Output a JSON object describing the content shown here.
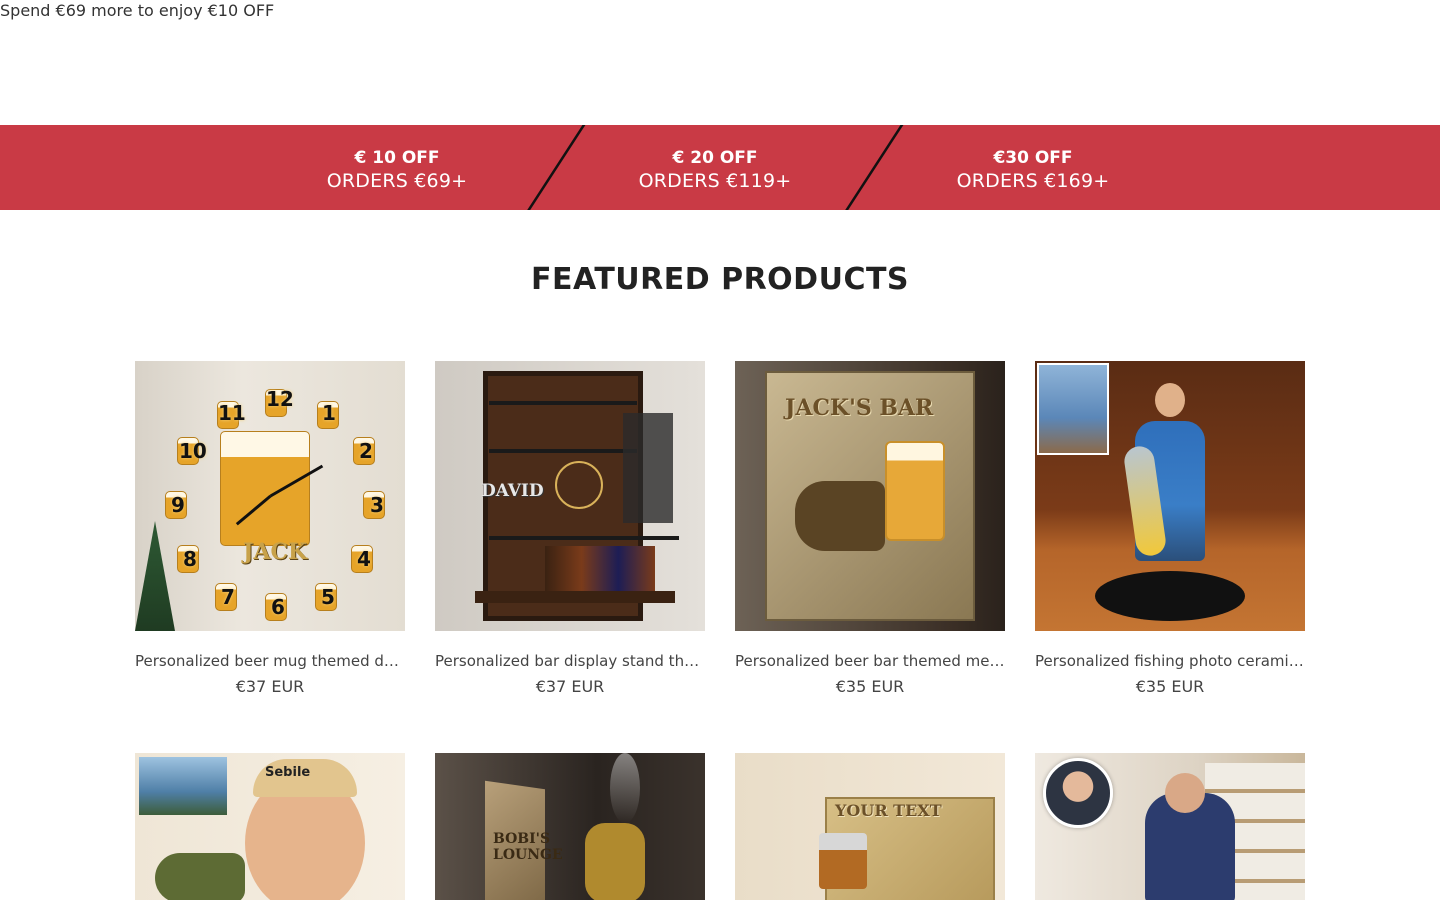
{
  "announcement": {
    "text": "Spend €69 more to enjoy €10 OFF"
  },
  "promo": {
    "tiers": [
      {
        "amount": "€ 10 OFF",
        "orders": "ORDERS €69+"
      },
      {
        "amount": "€ 20 OFF",
        "orders": "ORDERS €119+"
      },
      {
        "amount": "€30 OFF",
        "orders": "ORDERS €169+"
      }
    ],
    "color": "#c93a45"
  },
  "featured": {
    "title": "FEATURED PRODUCTS",
    "products": [
      {
        "title": "Personalized beer mug themed decorative wall clock",
        "price": "€37 EUR",
        "image_text": "JACK",
        "clock_numbers": [
          "12",
          "1",
          "2",
          "3",
          "4",
          "5",
          "6",
          "7",
          "8",
          "9",
          "10",
          "11"
        ]
      },
      {
        "title": "Personalized bar display stand themed wall clock",
        "price": "€37 EUR",
        "image_text": "DAVID"
      },
      {
        "title": "Personalized beer bar themed metal sign",
        "price": "€35 EUR",
        "image_text": "JACK'S BAR"
      },
      {
        "title": "Personalized fishing photo ceramic figurine",
        "price": "€35 EUR",
        "image_text": ""
      },
      {
        "title": "",
        "price": "",
        "image_text": "Sebile"
      },
      {
        "title": "",
        "price": "",
        "image_text": "BOBI'S LOUNGE"
      },
      {
        "title": "",
        "price": "",
        "image_text": "YOUR TEXT"
      },
      {
        "title": "",
        "price": "",
        "image_text": ""
      }
    ]
  }
}
